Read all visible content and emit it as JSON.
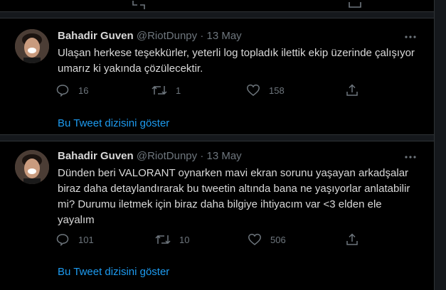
{
  "tweets": [
    {
      "name": "Bahadir Guven",
      "handle": "@RiotDunpy",
      "sep": "·",
      "date": "13 May",
      "lines": [
        "Ulaşan herkese teşekkürler, yeterli log topladık ilettik ekip üzerinde çalışıyor",
        "umarız ki yakında çözülecektir."
      ],
      "replies": "16",
      "retweets": "1",
      "likes": "158",
      "show_thread": "Bu Tweet dizisini göster"
    },
    {
      "name": "Bahadir Guven",
      "handle": "@RiotDunpy",
      "sep": "·",
      "date": "13 May",
      "lines": [
        "Dünden beri VALORANT oynarken mavi ekran sorunu yaşayan arkadşalar",
        "biraz daha detaylandırarak bu tweetin altında bana ne yaşıyorlar anlatabilir",
        "mi? Durumu iletmek için biraz daha bilgiye ihtiyacım var <3 elden ele",
        "yayalım"
      ],
      "replies": "101",
      "retweets": "10",
      "likes": "506",
      "show_thread": "Bu Tweet dizisini göster"
    }
  ],
  "colors": {
    "background": "#000000",
    "separator": "#15181c",
    "text": "#d9d9d9",
    "muted": "#6e767d",
    "link": "#1d9bf0"
  }
}
